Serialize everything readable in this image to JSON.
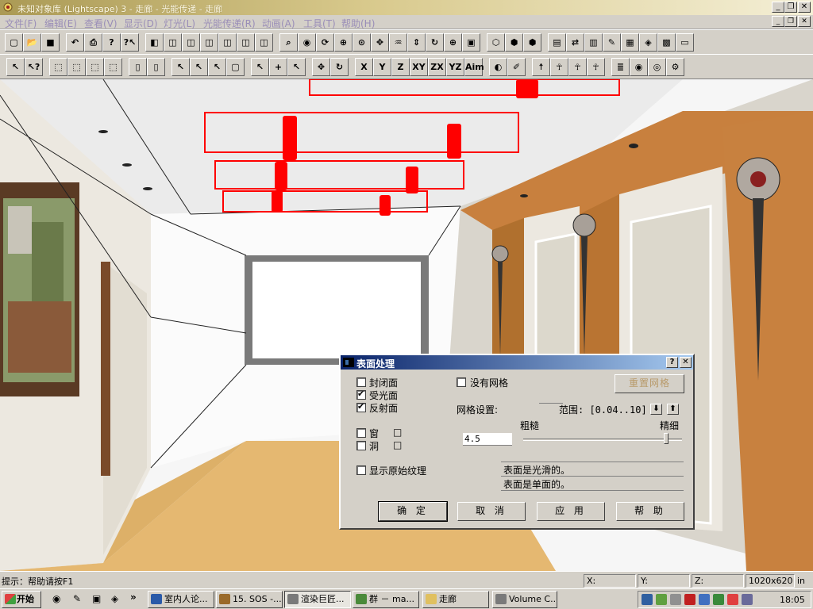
{
  "window": {
    "title": "未知对象库 (Lightscape) 3 - 走廊 - 光能传递 - 走廊"
  },
  "menu": [
    "文件(F)",
    "编辑(E)",
    "查看(V)",
    "显示(D)",
    "灯光(L)",
    "光能传递(R)",
    "动画(A)",
    "工具(T)",
    "帮助(H)"
  ],
  "toolbar1": [
    {
      "icon": "new-icon",
      "glyph": "▢"
    },
    {
      "icon": "open-icon",
      "glyph": "📂"
    },
    {
      "icon": "save-icon",
      "glyph": "■"
    },
    {
      "icon": "undo-icon",
      "glyph": "↶"
    },
    {
      "icon": "print-icon",
      "glyph": "⎙"
    },
    {
      "icon": "help-icon",
      "glyph": "?"
    },
    {
      "icon": "context-help-icon",
      "glyph": "?↖"
    },
    {
      "icon": "view-icon",
      "glyph": "◧"
    },
    {
      "icon": "cube1-icon",
      "glyph": "◫"
    },
    {
      "icon": "cube2-icon",
      "glyph": "◫"
    },
    {
      "icon": "cube3-icon",
      "glyph": "◫"
    },
    {
      "icon": "cube4-icon",
      "glyph": "◫"
    },
    {
      "icon": "cube5-icon",
      "glyph": "◫"
    },
    {
      "icon": "cube6-icon",
      "glyph": "◫"
    },
    {
      "icon": "search-icon",
      "glyph": "⌕"
    },
    {
      "icon": "eye-icon",
      "glyph": "◉"
    },
    {
      "icon": "orbit-icon",
      "glyph": "⟳"
    },
    {
      "icon": "zoom-window-icon",
      "glyph": "⊕"
    },
    {
      "icon": "zoom-icon",
      "glyph": "⊙"
    },
    {
      "icon": "pan-icon",
      "glyph": "✥"
    },
    {
      "icon": "walk-icon",
      "glyph": "♒"
    },
    {
      "icon": "dolly-icon",
      "glyph": "⇕"
    },
    {
      "icon": "rotate-icon",
      "glyph": "↻"
    },
    {
      "icon": "zoom-extents-icon",
      "glyph": "⊕"
    },
    {
      "icon": "camera-icon",
      "glyph": "▣"
    },
    {
      "icon": "wireframe-icon",
      "glyph": "⬡"
    },
    {
      "icon": "green-cube-icon",
      "glyph": "⬢"
    },
    {
      "icon": "solid-cube-icon",
      "glyph": "⬢"
    },
    {
      "icon": "layers-icon",
      "glyph": "▤"
    },
    {
      "icon": "arrows-icon",
      "glyph": "⇄"
    },
    {
      "icon": "stack-icon",
      "glyph": "▥"
    },
    {
      "icon": "pencil-icon",
      "glyph": "✎"
    },
    {
      "icon": "texture-icon",
      "glyph": "▦"
    },
    {
      "icon": "palette-icon",
      "glyph": "◈"
    },
    {
      "icon": "image-icon",
      "glyph": "▩"
    },
    {
      "icon": "folder-icon",
      "glyph": "▭"
    }
  ],
  "toolbar2": [
    {
      "icon": "select-icon",
      "glyph": "↖"
    },
    {
      "icon": "select-help-icon",
      "glyph": "↖?"
    },
    {
      "icon": "select-box-icon",
      "glyph": "⬚"
    },
    {
      "icon": "select-box-2-icon",
      "glyph": "⬚"
    },
    {
      "icon": "deselect-icon",
      "glyph": "⬚"
    },
    {
      "icon": "deselect-2-icon",
      "glyph": "⬚"
    },
    {
      "icon": "page-icon",
      "glyph": "▯"
    },
    {
      "icon": "page-2-icon",
      "glyph": "▯"
    },
    {
      "icon": "pick-icon",
      "glyph": "↖"
    },
    {
      "icon": "pick-2-icon",
      "glyph": "↖"
    },
    {
      "icon": "pick-3-icon",
      "glyph": "↖"
    },
    {
      "icon": "object-icon",
      "glyph": "▢"
    },
    {
      "icon": "select-object-icon",
      "glyph": "↖"
    },
    {
      "icon": "move-plus-icon",
      "glyph": "+"
    },
    {
      "icon": "light-select-icon",
      "glyph": "↖"
    },
    {
      "icon": "move-icon",
      "glyph": "✥"
    },
    {
      "icon": "rotate-obj-icon",
      "glyph": "↻"
    },
    {
      "icon": "axis-x-icon",
      "glyph": "X"
    },
    {
      "icon": "axis-y-icon",
      "glyph": "Y"
    },
    {
      "icon": "axis-z-icon",
      "glyph": "Z"
    },
    {
      "icon": "plane-xy-icon",
      "glyph": "XY"
    },
    {
      "icon": "plane-zx-icon",
      "glyph": "ZX"
    },
    {
      "icon": "plane-yz-icon",
      "glyph": "YZ"
    },
    {
      "icon": "align-icon",
      "glyph": "Aim"
    },
    {
      "icon": "material-icon",
      "glyph": "◐"
    },
    {
      "icon": "brush-icon",
      "glyph": "✐"
    },
    {
      "icon": "run-icon",
      "glyph": "☨"
    },
    {
      "icon": "person-icon",
      "glyph": "☥"
    },
    {
      "icon": "person-2-icon",
      "glyph": "☥"
    },
    {
      "icon": "person-3-icon",
      "glyph": "☥"
    },
    {
      "icon": "layer-stack-icon",
      "glyph": "≣"
    },
    {
      "icon": "sphere-icon",
      "glyph": "◉"
    },
    {
      "icon": "render-icon",
      "glyph": "◎"
    },
    {
      "icon": "process-icon",
      "glyph": "⚙"
    }
  ],
  "dialog": {
    "title": "表面处理",
    "help_btn": "?",
    "close_btn": "✕",
    "checks": [
      {
        "label": "封闭面",
        "checked": false
      },
      {
        "label": "受光面",
        "checked": true
      },
      {
        "label": "反射面",
        "checked": true
      }
    ],
    "window_label": "窗",
    "hole_label": "洞",
    "no_mesh_label": "没有网格",
    "reset_mesh_btn": "重置网格",
    "mesh_settings_label": "网格设置:",
    "range_label": "范围: [0.04..10]",
    "coarse_label": "粗糙",
    "fine_label": "精细",
    "mesh_value": "4.5",
    "slider_fraction": 0.9,
    "show_texture_label": "显示原始纹理",
    "info_line1": "表面是光滑的。",
    "info_line2": "表面是单面的。",
    "ok_btn": "确 定",
    "cancel_btn": "取 消",
    "apply_btn": "应 用",
    "help_btn2": "帮 助"
  },
  "status": {
    "hint": "提示：帮助请按F1",
    "x_label": "X:",
    "y_label": "Y:",
    "z_label": "Z:",
    "resolution": "1020x620",
    "unit": "in"
  },
  "taskbar": {
    "start": "开始",
    "tasks": [
      {
        "label": "室内人论...",
        "color": "#2a5aa8"
      },
      {
        "label": "15. SOS -...",
        "color": "#9a6a2a"
      },
      {
        "label": "渲染巨匠...",
        "color": "#7a7a7a"
      },
      {
        "label": "群 － ma...",
        "color": "#4a8a3a"
      },
      {
        "label": "走廊",
        "color": "#e0c060"
      },
      {
        "label": "Volume C...",
        "color": "#7a7a7a"
      }
    ],
    "clock": "18:05"
  },
  "colors": {
    "titlebar": "#ab9a55",
    "dialog_title": "#0a246a",
    "light_red": "#ff0000"
  }
}
